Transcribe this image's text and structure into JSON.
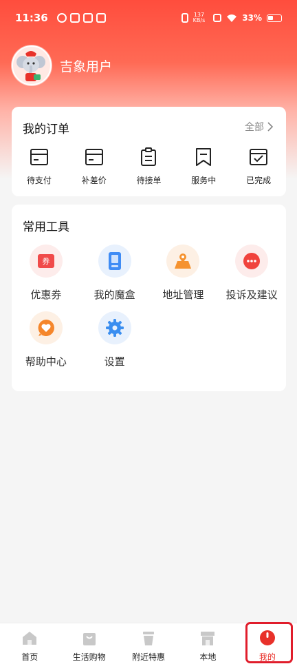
{
  "status_bar": {
    "time": "11:36",
    "speed_value": "137",
    "speed_unit": "KB/s",
    "battery": "33%"
  },
  "profile": {
    "username": "吉象用户",
    "avatar_icon": "elephant-mascot-avatar"
  },
  "orders": {
    "title": "我的订单",
    "see_all": "全部",
    "items": [
      {
        "label": "待支付",
        "icon": "wallet-icon"
      },
      {
        "label": "补差价",
        "icon": "card-icon"
      },
      {
        "label": "待接单",
        "icon": "clipboard-icon"
      },
      {
        "label": "服务中",
        "icon": "bookmark-icon"
      },
      {
        "label": "已完成",
        "icon": "check-box-icon"
      }
    ]
  },
  "tools": {
    "title": "常用工具",
    "items": [
      {
        "label": "优惠券",
        "icon": "coupon-icon",
        "color": "#f04a4a"
      },
      {
        "label": "我的魔盒",
        "icon": "magic-box-icon",
        "color": "#3f8cf5"
      },
      {
        "label": "地址管理",
        "icon": "map-icon",
        "color": "#f5922f"
      },
      {
        "label": "投诉及建议",
        "icon": "chat-bubble-icon",
        "color": "#f0433d"
      },
      {
        "label": "帮助中心",
        "icon": "help-heart-icon",
        "color": "#f5862b"
      },
      {
        "label": "设置",
        "icon": "gear-icon",
        "color": "#3a8ef0"
      }
    ],
    "coupon_char": "券"
  },
  "bottom_nav": {
    "items": [
      {
        "label": "首页",
        "icon": "home-icon"
      },
      {
        "label": "生活购物",
        "icon": "shopping-bag-icon"
      },
      {
        "label": "附近特惠",
        "icon": "cup-icon"
      },
      {
        "label": "本地",
        "icon": "store-icon"
      },
      {
        "label": "我的",
        "icon": "profile-drop-icon"
      }
    ],
    "active_index": 4,
    "active_color": "#e8312a"
  }
}
